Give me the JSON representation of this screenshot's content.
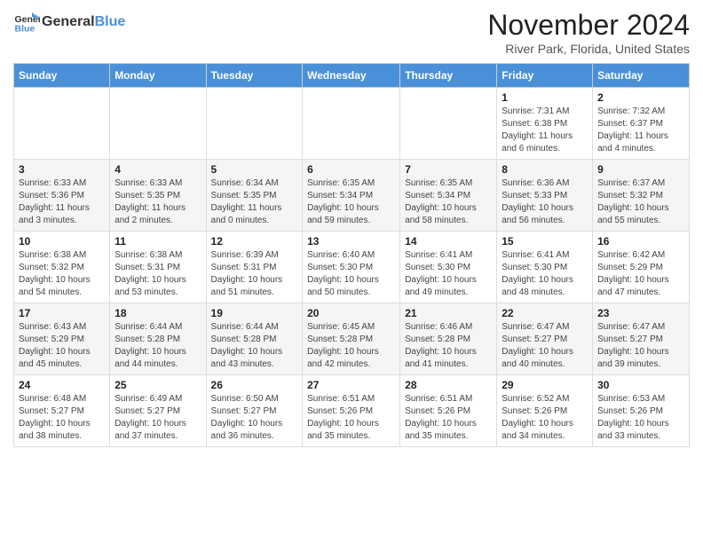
{
  "header": {
    "logo_general": "General",
    "logo_blue": "Blue",
    "month_year": "November 2024",
    "location": "River Park, Florida, United States"
  },
  "weekdays": [
    "Sunday",
    "Monday",
    "Tuesday",
    "Wednesday",
    "Thursday",
    "Friday",
    "Saturday"
  ],
  "weeks": [
    [
      {
        "day": "",
        "info": ""
      },
      {
        "day": "",
        "info": ""
      },
      {
        "day": "",
        "info": ""
      },
      {
        "day": "",
        "info": ""
      },
      {
        "day": "",
        "info": ""
      },
      {
        "day": "1",
        "info": "Sunrise: 7:31 AM\nSunset: 6:38 PM\nDaylight: 11 hours and 6 minutes."
      },
      {
        "day": "2",
        "info": "Sunrise: 7:32 AM\nSunset: 6:37 PM\nDaylight: 11 hours and 4 minutes."
      }
    ],
    [
      {
        "day": "3",
        "info": "Sunrise: 6:33 AM\nSunset: 5:36 PM\nDaylight: 11 hours and 3 minutes."
      },
      {
        "day": "4",
        "info": "Sunrise: 6:33 AM\nSunset: 5:35 PM\nDaylight: 11 hours and 2 minutes."
      },
      {
        "day": "5",
        "info": "Sunrise: 6:34 AM\nSunset: 5:35 PM\nDaylight: 11 hours and 0 minutes."
      },
      {
        "day": "6",
        "info": "Sunrise: 6:35 AM\nSunset: 5:34 PM\nDaylight: 10 hours and 59 minutes."
      },
      {
        "day": "7",
        "info": "Sunrise: 6:35 AM\nSunset: 5:34 PM\nDaylight: 10 hours and 58 minutes."
      },
      {
        "day": "8",
        "info": "Sunrise: 6:36 AM\nSunset: 5:33 PM\nDaylight: 10 hours and 56 minutes."
      },
      {
        "day": "9",
        "info": "Sunrise: 6:37 AM\nSunset: 5:32 PM\nDaylight: 10 hours and 55 minutes."
      }
    ],
    [
      {
        "day": "10",
        "info": "Sunrise: 6:38 AM\nSunset: 5:32 PM\nDaylight: 10 hours and 54 minutes."
      },
      {
        "day": "11",
        "info": "Sunrise: 6:38 AM\nSunset: 5:31 PM\nDaylight: 10 hours and 53 minutes."
      },
      {
        "day": "12",
        "info": "Sunrise: 6:39 AM\nSunset: 5:31 PM\nDaylight: 10 hours and 51 minutes."
      },
      {
        "day": "13",
        "info": "Sunrise: 6:40 AM\nSunset: 5:30 PM\nDaylight: 10 hours and 50 minutes."
      },
      {
        "day": "14",
        "info": "Sunrise: 6:41 AM\nSunset: 5:30 PM\nDaylight: 10 hours and 49 minutes."
      },
      {
        "day": "15",
        "info": "Sunrise: 6:41 AM\nSunset: 5:30 PM\nDaylight: 10 hours and 48 minutes."
      },
      {
        "day": "16",
        "info": "Sunrise: 6:42 AM\nSunset: 5:29 PM\nDaylight: 10 hours and 47 minutes."
      }
    ],
    [
      {
        "day": "17",
        "info": "Sunrise: 6:43 AM\nSunset: 5:29 PM\nDaylight: 10 hours and 45 minutes."
      },
      {
        "day": "18",
        "info": "Sunrise: 6:44 AM\nSunset: 5:28 PM\nDaylight: 10 hours and 44 minutes."
      },
      {
        "day": "19",
        "info": "Sunrise: 6:44 AM\nSunset: 5:28 PM\nDaylight: 10 hours and 43 minutes."
      },
      {
        "day": "20",
        "info": "Sunrise: 6:45 AM\nSunset: 5:28 PM\nDaylight: 10 hours and 42 minutes."
      },
      {
        "day": "21",
        "info": "Sunrise: 6:46 AM\nSunset: 5:28 PM\nDaylight: 10 hours and 41 minutes."
      },
      {
        "day": "22",
        "info": "Sunrise: 6:47 AM\nSunset: 5:27 PM\nDaylight: 10 hours and 40 minutes."
      },
      {
        "day": "23",
        "info": "Sunrise: 6:47 AM\nSunset: 5:27 PM\nDaylight: 10 hours and 39 minutes."
      }
    ],
    [
      {
        "day": "24",
        "info": "Sunrise: 6:48 AM\nSunset: 5:27 PM\nDaylight: 10 hours and 38 minutes."
      },
      {
        "day": "25",
        "info": "Sunrise: 6:49 AM\nSunset: 5:27 PM\nDaylight: 10 hours and 37 minutes."
      },
      {
        "day": "26",
        "info": "Sunrise: 6:50 AM\nSunset: 5:27 PM\nDaylight: 10 hours and 36 minutes."
      },
      {
        "day": "27",
        "info": "Sunrise: 6:51 AM\nSunset: 5:26 PM\nDaylight: 10 hours and 35 minutes."
      },
      {
        "day": "28",
        "info": "Sunrise: 6:51 AM\nSunset: 5:26 PM\nDaylight: 10 hours and 35 minutes."
      },
      {
        "day": "29",
        "info": "Sunrise: 6:52 AM\nSunset: 5:26 PM\nDaylight: 10 hours and 34 minutes."
      },
      {
        "day": "30",
        "info": "Sunrise: 6:53 AM\nSunset: 5:26 PM\nDaylight: 10 hours and 33 minutes."
      }
    ]
  ]
}
